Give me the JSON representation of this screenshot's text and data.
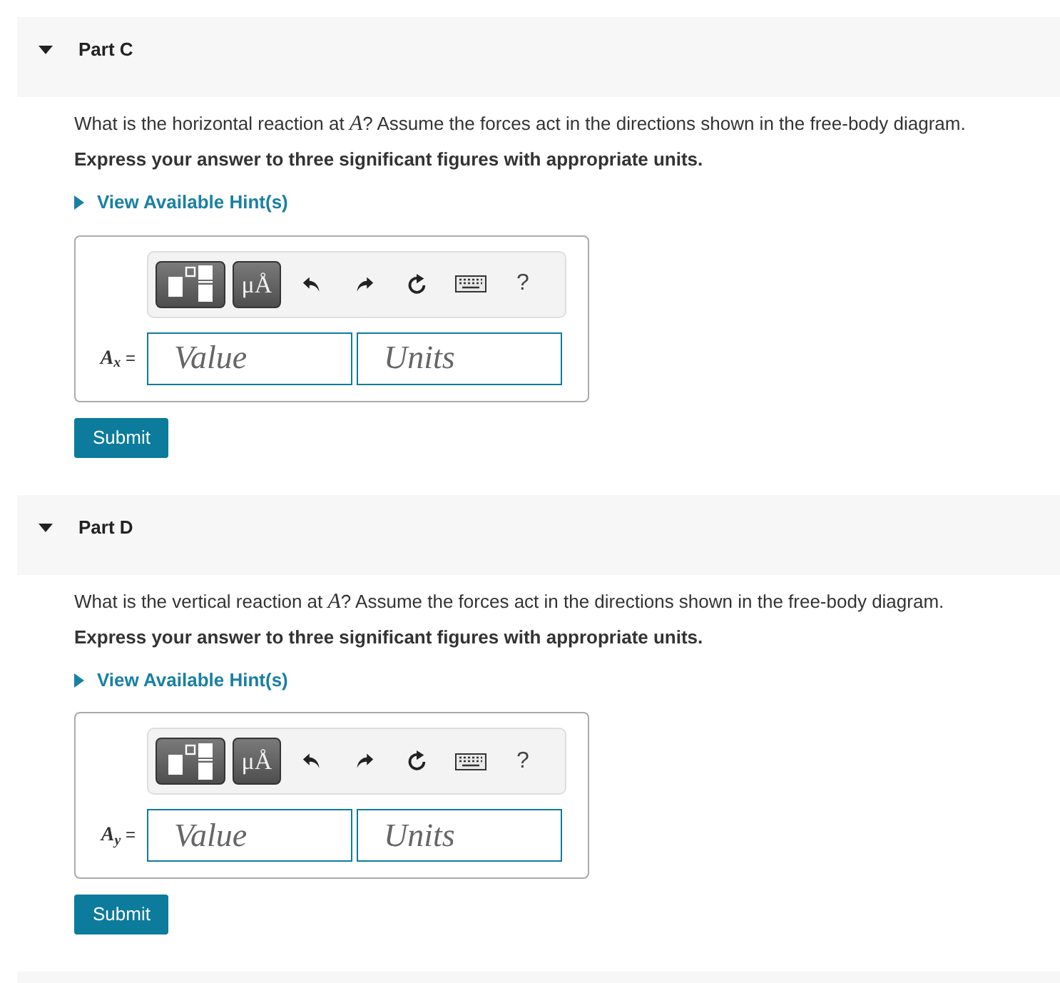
{
  "parts": [
    {
      "title": "Part C",
      "expanded": true,
      "question": "What is the horizontal reaction at *A*? Assume the forces act in the directions shown in the free-body diagram.",
      "instruction": "Express your answer to three significant figures with appropriate units.",
      "hint": {
        "label": "View Available Hint(s)",
        "expanded": false
      },
      "toolbar": {
        "units_button": "μÅ",
        "help_button": "?"
      },
      "answer": {
        "label": "*A*$_{x}$ =",
        "value_placeholder": "Value",
        "units_placeholder": "Units"
      },
      "submit": "Submit"
    },
    {
      "title": "Part D",
      "expanded": true,
      "question": "What is the vertical reaction at *A*? Assume the forces act in the directions shown in the free-body diagram.",
      "instruction": "Express your answer to three significant figures with appropriate units.",
      "hint": {
        "label": "View Available Hint(s)",
        "expanded": false
      },
      "toolbar": {
        "units_button": "μÅ",
        "help_button": "?"
      },
      "answer": {
        "label": "*A*$_{y}$ =",
        "value_placeholder": "Value",
        "units_placeholder": "Units"
      },
      "submit": "Submit"
    }
  ]
}
